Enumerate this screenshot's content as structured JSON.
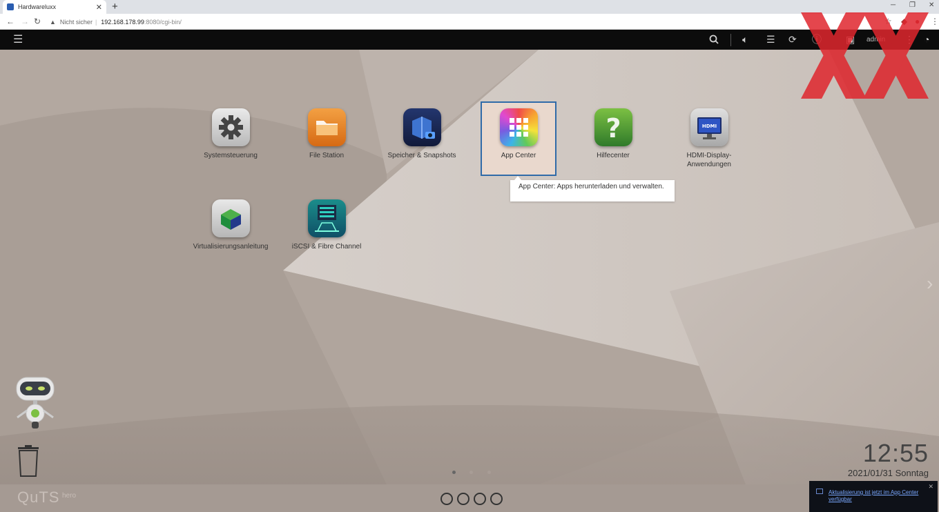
{
  "browser": {
    "tab_title": "Hardwareluxx",
    "tab_close": "✕",
    "new_tab": "+",
    "security_label": "Nicht sicher",
    "url_host": "192.168.178.99",
    "url_path": ":8080/cgi-bin/"
  },
  "topbar": {
    "user": "admin"
  },
  "apps": [
    {
      "label": "Systemsteuerung",
      "icon": "gear-icon"
    },
    {
      "label": "File Station",
      "icon": "folder-icon"
    },
    {
      "label": "Speicher & Snapshots",
      "icon": "storage-icon"
    },
    {
      "label": "App Center",
      "icon": "grid-icon"
    },
    {
      "label": "Hilfecenter",
      "icon": "question-icon"
    },
    {
      "label": "HDMI-Display-Anwendungen",
      "icon": "monitor-icon"
    },
    {
      "label": "Virtualisierungsanleitung",
      "icon": "cube-icon"
    },
    {
      "label": "iSCSI & Fibre Channel",
      "icon": "server-icon"
    }
  ],
  "tooltip": "App Center: Apps herunterladen und verwalten.",
  "hdmi_text": "HDMI",
  "clock": {
    "time": "12:55",
    "date": "2021/01/31 Sonntag"
  },
  "logo": {
    "main": "QuTS",
    "sub": "hero"
  },
  "notification": {
    "text": "Aktualisierung ist jetzt im App Center verfügbar",
    "close": "✕"
  },
  "colors": {
    "accent": "#2f6aa8",
    "watermark": "#e0262e",
    "topbar": "#0c0c0c"
  }
}
